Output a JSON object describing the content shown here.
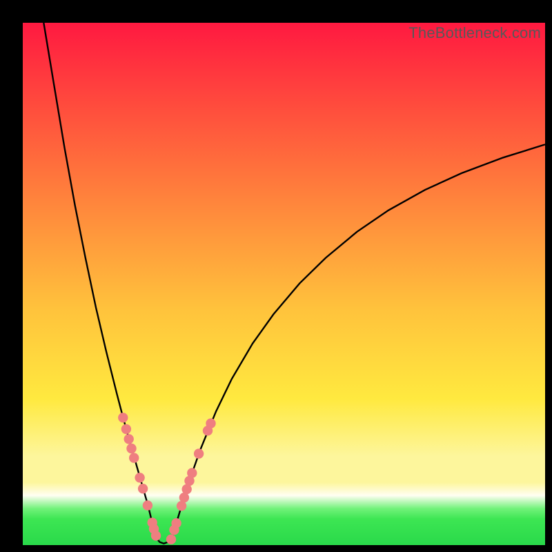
{
  "attribution": "TheBottleneck.com",
  "chart_data": {
    "type": "line",
    "title": "",
    "xlabel": "",
    "ylabel": "",
    "xlim": [
      0,
      100
    ],
    "ylim": [
      0,
      100
    ],
    "series": [
      {
        "name": "left-branch",
        "x": [
          4,
          6,
          8,
          10,
          12,
          14,
          16,
          18,
          19,
          20,
          21,
          22,
          23,
          24,
          24.8,
          25.4
        ],
        "y": [
          100,
          88,
          76,
          65,
          55,
          45.5,
          37,
          29,
          25.2,
          21.5,
          18,
          14.5,
          11,
          7.5,
          4.2,
          1.6
        ]
      },
      {
        "name": "valley-floor",
        "x": [
          25.4,
          26.2,
          27.0,
          27.8,
          28.6
        ],
        "y": [
          1.6,
          0.6,
          0.3,
          0.6,
          1.5
        ]
      },
      {
        "name": "right-branch",
        "x": [
          28.6,
          30,
          32,
          34,
          37,
          40,
          44,
          48,
          53,
          58,
          64,
          70,
          77,
          84,
          92,
          100
        ],
        "y": [
          1.5,
          6.2,
          12.6,
          18.3,
          25.6,
          31.8,
          38.6,
          44.2,
          50.1,
          55,
          60,
          64.1,
          68,
          71.2,
          74.2,
          76.7
        ]
      }
    ],
    "markers": [
      {
        "branch": "left",
        "x": 19.2,
        "y": 24.4
      },
      {
        "branch": "left",
        "x": 19.8,
        "y": 22.2
      },
      {
        "branch": "left",
        "x": 20.3,
        "y": 20.3
      },
      {
        "branch": "left",
        "x": 20.8,
        "y": 18.5
      },
      {
        "branch": "left",
        "x": 21.3,
        "y": 16.7
      },
      {
        "branch": "left",
        "x": 22.4,
        "y": 12.9
      },
      {
        "branch": "left",
        "x": 23.0,
        "y": 10.8
      },
      {
        "branch": "left",
        "x": 23.9,
        "y": 7.6
      },
      {
        "branch": "left",
        "x": 24.8,
        "y": 4.3
      },
      {
        "branch": "left",
        "x": 25.1,
        "y": 3.1
      },
      {
        "branch": "left",
        "x": 25.5,
        "y": 1.8
      },
      {
        "branch": "right",
        "x": 28.4,
        "y": 1.1
      },
      {
        "branch": "right",
        "x": 29.0,
        "y": 2.9
      },
      {
        "branch": "right",
        "x": 29.4,
        "y": 4.2
      },
      {
        "branch": "right",
        "x": 30.4,
        "y": 7.5
      },
      {
        "branch": "right",
        "x": 30.9,
        "y": 9.1
      },
      {
        "branch": "right",
        "x": 31.4,
        "y": 10.7
      },
      {
        "branch": "right",
        "x": 31.9,
        "y": 12.3
      },
      {
        "branch": "right",
        "x": 32.4,
        "y": 13.8
      },
      {
        "branch": "right",
        "x": 33.7,
        "y": 17.5
      },
      {
        "branch": "right",
        "x": 35.4,
        "y": 21.9
      },
      {
        "branch": "right",
        "x": 36.0,
        "y": 23.3
      }
    ],
    "marker_style": {
      "color": "#ef7e80",
      "radius_pct": 0.95
    }
  },
  "colors": {
    "curve": "#000000",
    "marker": "#ef7e80",
    "frame": "#000000"
  }
}
